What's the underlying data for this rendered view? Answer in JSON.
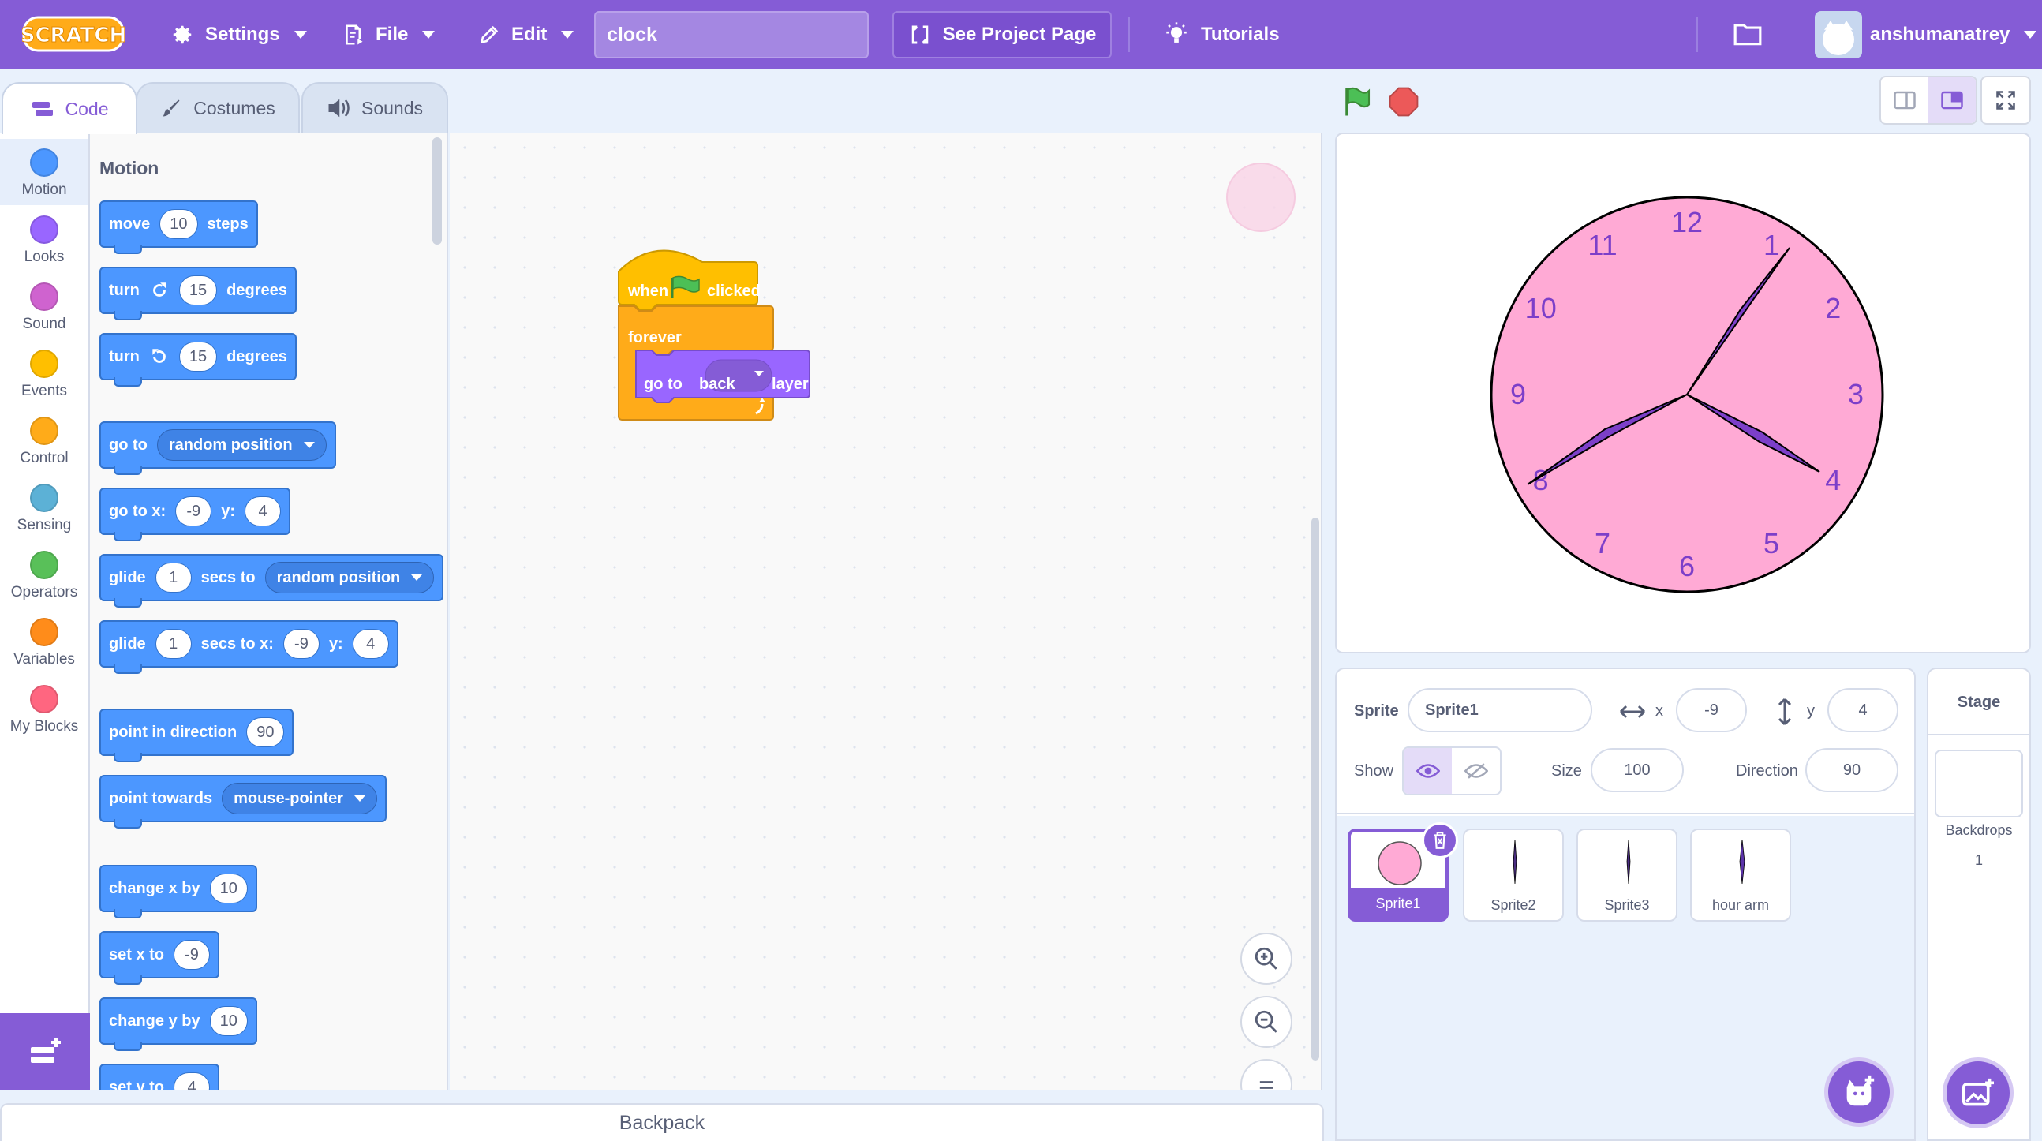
{
  "menu": {
    "settings": "Settings",
    "file": "File",
    "edit": "Edit",
    "project_title": "clock",
    "see_project": "See Project Page",
    "tutorials": "Tutorials",
    "username": "anshumanatrey"
  },
  "tabs": {
    "code": "Code",
    "costumes": "Costumes",
    "sounds": "Sounds"
  },
  "categories": [
    {
      "label": "Motion",
      "color": "#4c97ff"
    },
    {
      "label": "Looks",
      "color": "#9966ff"
    },
    {
      "label": "Sound",
      "color": "#cf63cf"
    },
    {
      "label": "Events",
      "color": "#ffbf00"
    },
    {
      "label": "Control",
      "color": "#ffab19"
    },
    {
      "label": "Sensing",
      "color": "#5cb1d6"
    },
    {
      "label": "Operators",
      "color": "#59c059"
    },
    {
      "label": "Variables",
      "color": "#ff8c1a"
    },
    {
      "label": "My Blocks",
      "color": "#ff6680"
    }
  ],
  "palette": {
    "title": "Motion",
    "move": {
      "a": "move",
      "v": "10",
      "b": "steps"
    },
    "turn_cw": {
      "a": "turn",
      "v": "15",
      "b": "degrees"
    },
    "turn_ccw": {
      "a": "turn",
      "v": "15",
      "b": "degrees"
    },
    "goto": {
      "a": "go to",
      "d": "random position"
    },
    "gotoxy": {
      "a": "go to x:",
      "x": "-9",
      "b": "y:",
      "y": "4"
    },
    "glide1": {
      "a": "glide",
      "v": "1",
      "b": "secs to",
      "d": "random position"
    },
    "glide2": {
      "a": "glide",
      "v": "1",
      "b": "secs to x:",
      "x": "-9",
      "c": "y:",
      "y": "4"
    },
    "point_dir": {
      "a": "point in direction",
      "v": "90"
    },
    "point_towards": {
      "a": "point towards",
      "d": "mouse-pointer"
    },
    "change_x": {
      "a": "change x by",
      "v": "10"
    },
    "set_x": {
      "a": "set x to",
      "v": "-9"
    },
    "change_y": {
      "a": "change y by",
      "v": "10"
    },
    "set_y": {
      "a": "set y to",
      "v": "4"
    }
  },
  "script": {
    "hat_when": "when",
    "hat_clicked": "clicked",
    "forever": "forever",
    "goto_a": "go to",
    "goto_layer": "back",
    "goto_b": "layer"
  },
  "backpack": "Backpack",
  "sprite_info": {
    "sprite_label": "Sprite",
    "sprite_name": "Sprite1",
    "x_label": "x",
    "x": "-9",
    "y_label": "y",
    "y": "4",
    "show_label": "Show",
    "size_label": "Size",
    "size": "100",
    "direction_label": "Direction",
    "direction": "90"
  },
  "sprites": [
    {
      "name": "Sprite1",
      "selected": true
    },
    {
      "name": "Sprite2"
    },
    {
      "name": "Sprite3"
    },
    {
      "name": "hour arm"
    }
  ],
  "stage_pane": {
    "title": "Stage",
    "backdrops_label": "Backdrops",
    "backdrops_count": "1"
  },
  "clock": {
    "face_color": "#ffaad5",
    "hand_color": "#7c3fc9",
    "numbers": [
      "12",
      "1",
      "2",
      "3",
      "4",
      "5",
      "6",
      "7",
      "8",
      "9",
      "10",
      "11"
    ]
  },
  "icons": {
    "logo": "scratch-logo",
    "settings": "gear-icon",
    "file": "file-icon",
    "edit": "pencil-icon",
    "see_project": "remix-arrows-icon",
    "tutorials": "lightbulb-icon",
    "folder": "folder-icon",
    "green_flag": "green-flag-icon",
    "stop": "stop-icon"
  }
}
